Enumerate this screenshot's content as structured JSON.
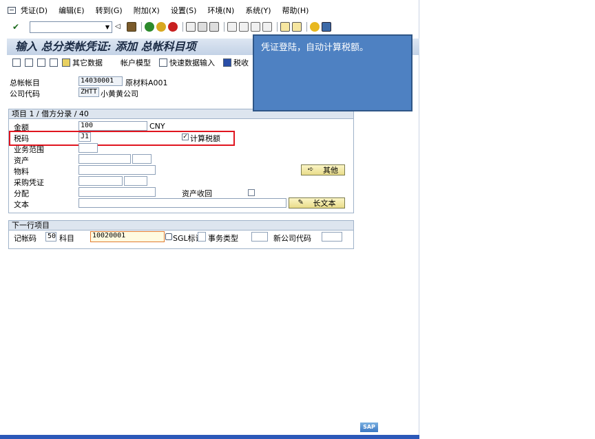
{
  "menu": {
    "items": [
      "凭证(D)",
      "编辑(E)",
      "转到(G)",
      "附加(X)",
      "设置(S)",
      "环境(N)",
      "系统(Y)",
      "帮助(H)"
    ]
  },
  "toolbar": {
    "command_value": ""
  },
  "title": "输入 总分类帐凭证: 添加 总帐科目项",
  "app_toolbar": {
    "other_data": "其它数据",
    "account_model": "帐户模型",
    "fast_entry": "快速数据输入",
    "tax": "税收"
  },
  "header": {
    "gl_account_label": "总帐帐目",
    "gl_account_value": "14030001",
    "gl_account_desc": "原材料A001",
    "company_code_label": "公司代码",
    "company_code_value": "ZHTT",
    "company_code_desc": "小黄黄公司"
  },
  "item_group": {
    "header": "项目 1 / 借方分录 / 40",
    "amount_label": "金额",
    "amount_value": "100",
    "currency": "CNY",
    "tax_code_label": "税码",
    "tax_code_value": "J1",
    "calc_tax_label": "计算税额",
    "calc_tax_checked": "✓",
    "business_area_label": "业务范围",
    "asset_label": "资产",
    "material_label": "物料",
    "purchase_doc_label": "采购凭证",
    "assignment_label": "分配",
    "asset_retirement_label": "资产收回",
    "text_label": "文本",
    "more_button": "其他",
    "long_text_button": "长文本"
  },
  "next_item": {
    "header": "下一行项目",
    "posting_key_label": "记帐码",
    "posting_key_value": "50",
    "account_label": "科目",
    "account_value": "10020001",
    "sgl_label": "SGL标识",
    "trans_type_label": "事务类型",
    "new_company_label": "新公司代码"
  },
  "callout": {
    "text": "凭证登陆，自动计算税额。"
  },
  "colors": {
    "callout_bg": "#4e81c2",
    "highlight_red": "#e0141e",
    "title_bg": "#c3d2e6"
  },
  "logo": "SAP"
}
